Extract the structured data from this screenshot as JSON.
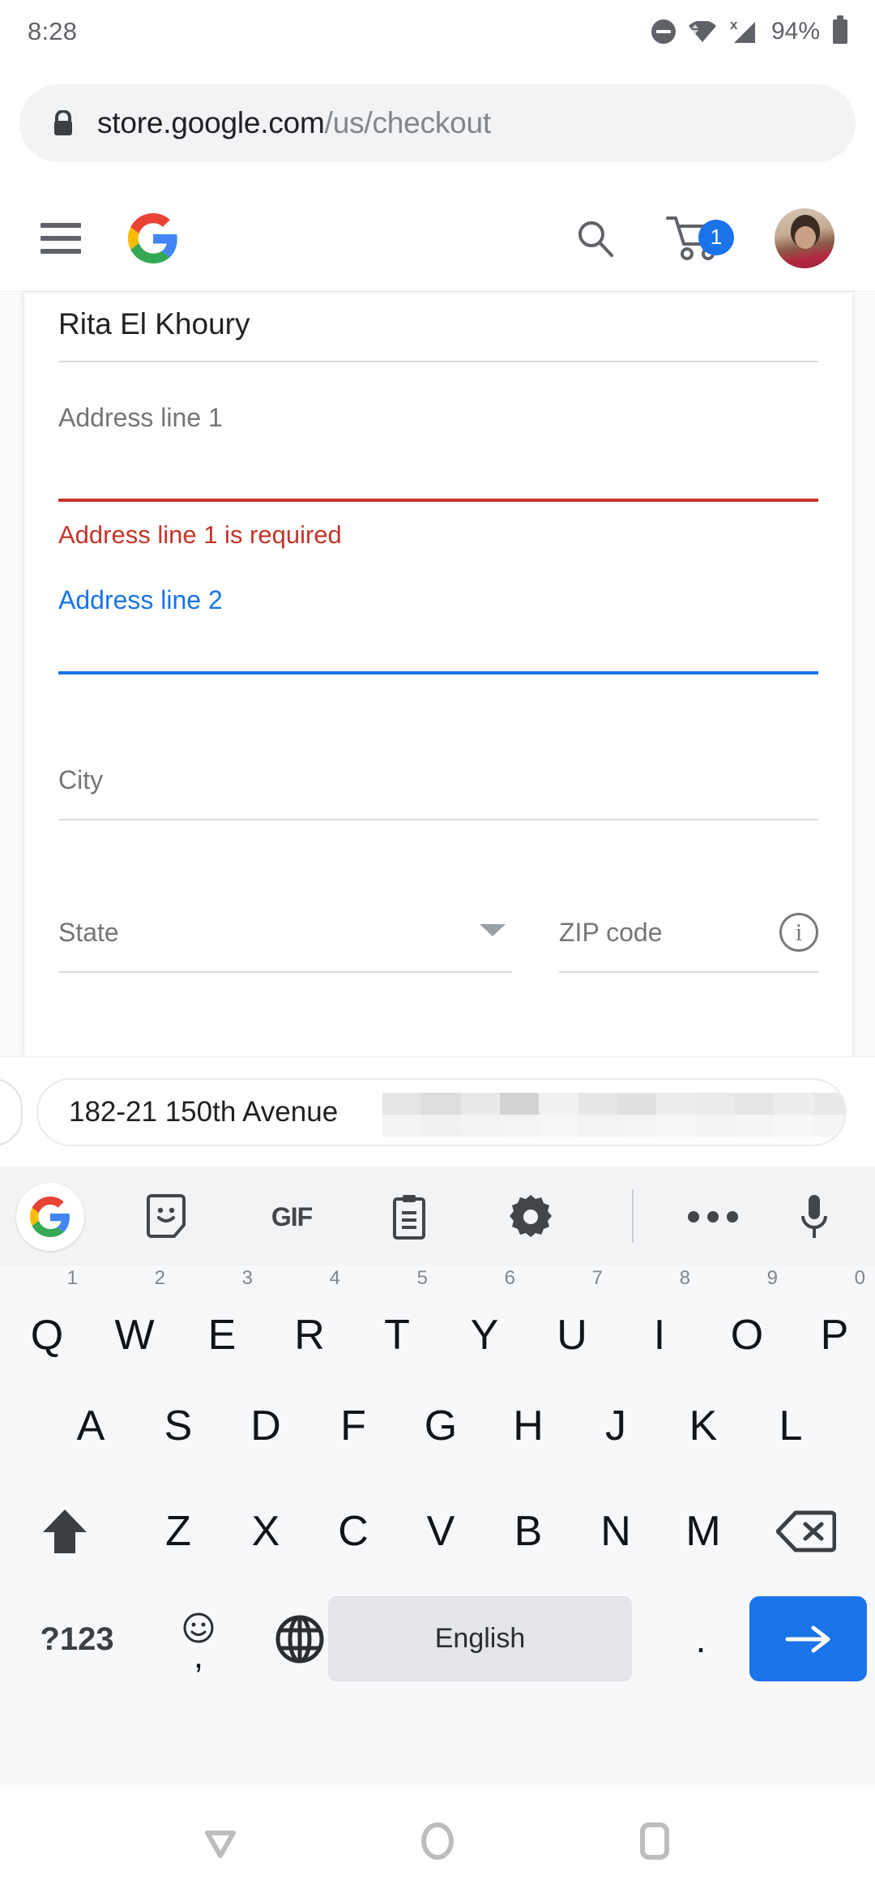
{
  "status_bar": {
    "time": "8:28",
    "battery_percent": "94%",
    "icons": [
      "do-not-disturb-icon",
      "wifi-icon",
      "cell-signal-no-sim-icon",
      "battery-icon"
    ],
    "signal_badge": "x"
  },
  "browser": {
    "url_domain": "store.google.com",
    "url_path": "/us/checkout",
    "lock_icon": "lock-icon"
  },
  "site_header": {
    "menu_icon": "hamburger-menu-icon",
    "logo": "google-g-logo",
    "search_icon": "search-icon",
    "cart_icon": "shopping-cart-icon",
    "cart_count": "1",
    "avatar": "user-avatar"
  },
  "checkout_form": {
    "name_value": "Rita El Khoury",
    "address1_label": "Address line 1",
    "address1_error": "Address line 1 is required",
    "address2_label": "Address line 2",
    "city_label": "City",
    "state_label": "State",
    "zip_label": "ZIP code",
    "zip_info_icon": "info-icon",
    "state_caret_icon": "chevron-down-icon",
    "error_color": "#c5342a",
    "focus_color": "#1a73e8"
  },
  "autofill": {
    "suggestion": "182-21 150th Avenue",
    "redacted": true
  },
  "keyboard": {
    "toolbar": [
      {
        "name": "google-logo-icon",
        "label": ""
      },
      {
        "name": "sticker-icon",
        "label": ""
      },
      {
        "name": "gif-icon",
        "label": "GIF"
      },
      {
        "name": "clipboard-icon",
        "label": ""
      },
      {
        "name": "settings-gear-icon",
        "label": ""
      },
      {
        "name": "more-options-icon",
        "label": ""
      },
      {
        "name": "microphone-icon",
        "label": ""
      }
    ],
    "row1": [
      {
        "key": "Q",
        "hint": "1"
      },
      {
        "key": "W",
        "hint": "2"
      },
      {
        "key": "E",
        "hint": "3"
      },
      {
        "key": "R",
        "hint": "4"
      },
      {
        "key": "T",
        "hint": "5"
      },
      {
        "key": "Y",
        "hint": "6"
      },
      {
        "key": "U",
        "hint": "7"
      },
      {
        "key": "I",
        "hint": "8"
      },
      {
        "key": "O",
        "hint": "9"
      },
      {
        "key": "P",
        "hint": "0"
      }
    ],
    "row2": [
      {
        "key": "A"
      },
      {
        "key": "S"
      },
      {
        "key": "D"
      },
      {
        "key": "F"
      },
      {
        "key": "G"
      },
      {
        "key": "H"
      },
      {
        "key": "J"
      },
      {
        "key": "K"
      },
      {
        "key": "L"
      }
    ],
    "row3": [
      {
        "key": "Z"
      },
      {
        "key": "X"
      },
      {
        "key": "C"
      },
      {
        "key": "V"
      },
      {
        "key": "B"
      },
      {
        "key": "N"
      },
      {
        "key": "M"
      }
    ],
    "shift_icon": "shift-up-arrow-icon",
    "backspace_icon": "backspace-icon",
    "symbols_label": "?123",
    "emoji_comma_label": ",",
    "emoji_icon": "emoji-smiley-icon",
    "language_icon": "globe-icon",
    "space_label": "English",
    "period_label": ".",
    "enter_icon": "enter-arrow-icon",
    "enter_color": "#1a73e8"
  },
  "nav_bar": {
    "back_icon": "back-triangle-icon",
    "home_icon": "home-circle-icon",
    "recents_icon": "recents-square-icon"
  }
}
